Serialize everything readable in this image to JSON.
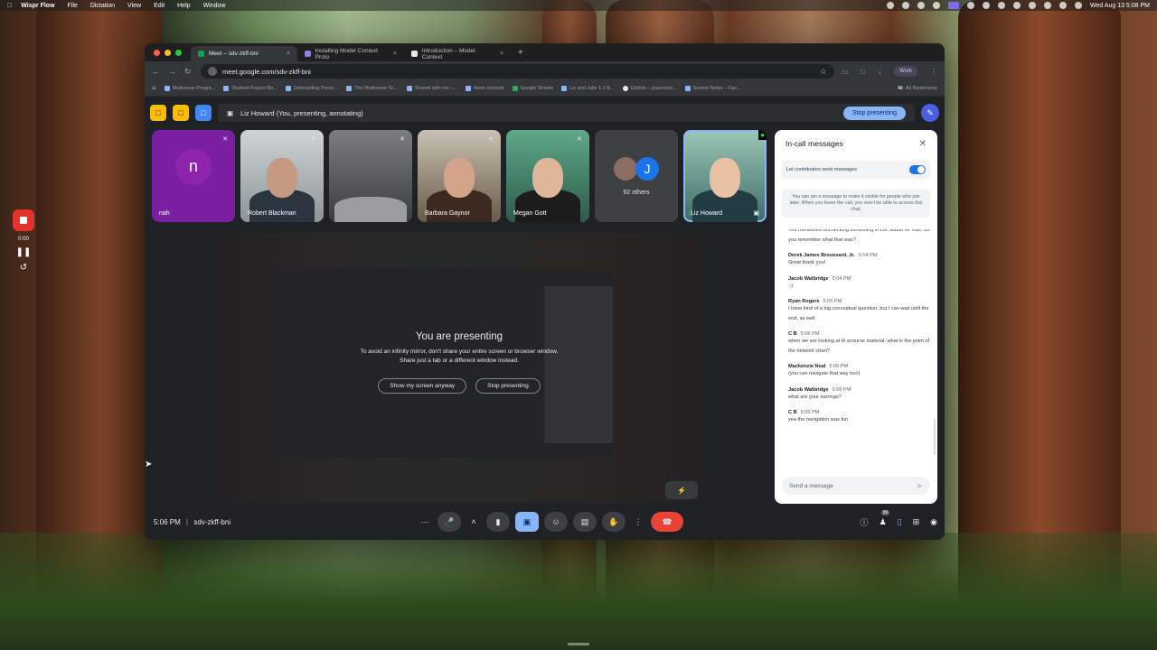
{
  "menubar": {
    "app": "Wispr Flow",
    "items": [
      "File",
      "Dictation",
      "View",
      "Edit",
      "Help",
      "Window"
    ],
    "datetime": "Wed Aug 13  5:08 PM"
  },
  "recorder": {
    "time": "0:00"
  },
  "browser": {
    "tabs": [
      {
        "label": "Meet – sdv-zkff-bni",
        "color": "#00ac47"
      },
      {
        "label": "Installing Model Context Proto",
        "color": "#8e7cf0"
      },
      {
        "label": "Introduction – Model Context",
        "color": "#e8eaed"
      }
    ],
    "url": "meet.google.com/sdv-zkff-bni",
    "profile": "Work",
    "bookmarks": [
      "Multiverse Progra...",
      "Student Project Bo...",
      "Onboarding Proce...",
      "The Multiverse Sc...",
      "Shared with me –...",
      "Neon console",
      "Google Sheets",
      "Liz and Julie 1:1 B...",
      "GitHub – joaocesin...",
      "Sonnet Notes – Fac..."
    ],
    "all_bookmarks": "All Bookmarks"
  },
  "meet": {
    "presenting_label": "Liz Howard (You, presenting, annotating)",
    "stop_presenting": "Stop presenting",
    "participants": [
      {
        "name": "nah",
        "kind": "avatar",
        "initial": "n"
      },
      {
        "name": "Robert Blackman",
        "kind": "video"
      },
      {
        "name": "",
        "kind": "video"
      },
      {
        "name": "Barbara Gaynor",
        "kind": "video"
      },
      {
        "name": "Megan Gott",
        "kind": "video"
      },
      {
        "name": "92 others",
        "kind": "others",
        "initial": "J"
      },
      {
        "name": "Liz Howard",
        "kind": "video"
      }
    ],
    "presenting_title": "You are presenting",
    "presenting_sub1": "To avoid an infinity mirror, don't share your entire screen or browser window.",
    "presenting_sub2": "Share just a tab or a different window instead.",
    "show_anyway": "Show my screen anyway",
    "stop_btn": "Stop presenting",
    "clock": "5:06 PM",
    "separator": "|",
    "meeting_code": "sdv-zkff-bni",
    "people_count": "99"
  },
  "chat": {
    "title": "In-call messages",
    "toggle_label": "Let contributors send messages",
    "pin_note": "You can pin a message to make it visible for people who join later. When you leave the call, you won't be able to access this chat.",
    "first_text": "You mentioned unchecking something in LM Studio for mac, do you remember what that was?",
    "messages": [
      {
        "who": "Derek James Broussard, Jr.",
        "time": "5:04 PM",
        "text": "Great thank you!"
      },
      {
        "who": "Jacob Walbridge",
        "time": "5:04 PM",
        "text": ":-)"
      },
      {
        "who": "Ryan Rogers",
        "time": "5:05 PM",
        "text": "I have kind of a big conceptual question, but I can wait until the end, as well."
      },
      {
        "who": "C B",
        "time": "5:06 PM",
        "text": "when we are looking at th ecourse material, what is the point of the network chart?"
      },
      {
        "who": "Mackenzie Neal",
        "time": "5:06 PM",
        "text": "(you can navigate that way too!)"
      },
      {
        "who": "Jacob Walbridge",
        "time": "5:06 PM",
        "text": "what are your earrings?"
      },
      {
        "who": "C B",
        "time": "5:06 PM",
        "text": "yea the navigation was fun"
      }
    ],
    "placeholder": "Send a message"
  }
}
